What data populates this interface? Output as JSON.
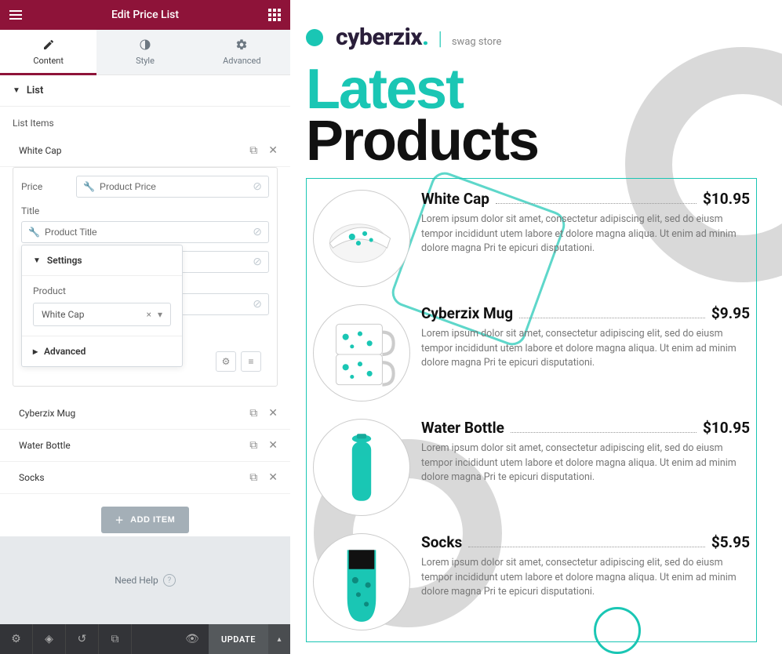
{
  "editor": {
    "title": "Edit Price List",
    "tabs": {
      "content": "Content",
      "style": "Style",
      "advanced": "Advanced"
    },
    "section": "List",
    "list_items_label": "List Items",
    "items": [
      {
        "name": "White Cap"
      },
      {
        "name": "Cyberzix Mug"
      },
      {
        "name": "Water Bottle"
      },
      {
        "name": "Socks"
      }
    ],
    "fields": {
      "price_label": "Price",
      "price_value": "Product Price",
      "title_label": "Title",
      "title_value": "Product Title",
      "settings_label": "Settings",
      "product_label": "Product",
      "product_value": "White Cap",
      "advanced_label": "Advanced"
    },
    "add_item": "ADD ITEM",
    "need_help": "Need Help",
    "update": "UPDATE"
  },
  "preview": {
    "brand": "cyberzix",
    "brand_sub": "swag store",
    "heading_line1": "Latest",
    "heading_line2": "Products",
    "desc": "Lorem ipsum dolor sit amet, consectetur adipiscing elit, sed do eiusm tempor incididunt utem labore et dolore magna aliqua. Ut enim ad minim dolore magna Pri te epicuri disputationi.",
    "products": [
      {
        "title": "White Cap",
        "price": "$10.95"
      },
      {
        "title": "Cyberzix Mug",
        "price": "$9.95"
      },
      {
        "title": "Water Bottle",
        "price": "$10.95"
      },
      {
        "title": "Socks",
        "price": "$5.95"
      }
    ]
  }
}
